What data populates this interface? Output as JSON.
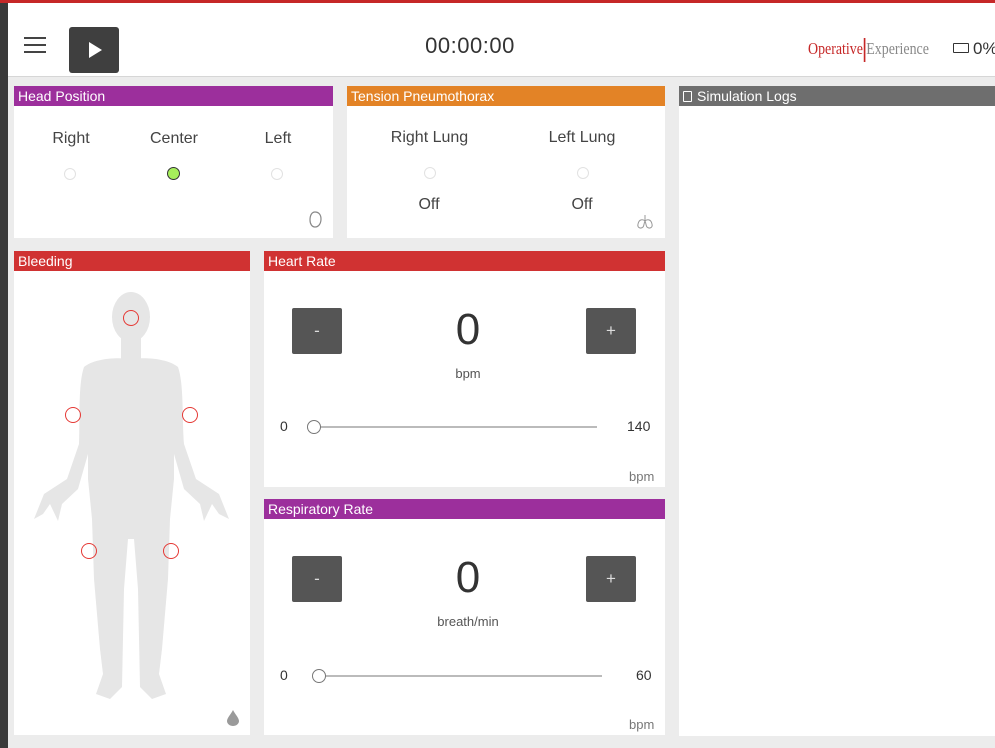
{
  "header": {
    "timer": "00:00:00",
    "brand_primary": "Operative",
    "brand_secondary": "Experience",
    "battery": "0%"
  },
  "colors": {
    "accent_red": "#c62828",
    "panel_purple": "#9c2f9c",
    "panel_orange": "#e38326",
    "panel_red": "#d03232",
    "panel_gray": "#6e6e6e",
    "radio_selected": "#a6ef5b"
  },
  "head_position": {
    "title": "Head Position",
    "options": [
      "Right",
      "Center",
      "Left"
    ],
    "selected": "Center",
    "icon": "head-icon"
  },
  "tension_pneumothorax": {
    "title": "Tension Pneumothorax",
    "right_lung": {
      "label": "Right Lung",
      "status": "Off"
    },
    "left_lung": {
      "label": "Left Lung",
      "status": "Off"
    },
    "icon": "lungs-icon"
  },
  "bleeding": {
    "title": "Bleeding",
    "sites": [
      "head",
      "right-arm",
      "left-arm",
      "right-leg",
      "left-leg"
    ],
    "icon": "blood-drop-icon"
  },
  "heart_rate": {
    "title": "Heart Rate",
    "decrement": "-",
    "increment": "+",
    "value": "0",
    "unit": "bpm",
    "slider_min": "0",
    "slider_max": "140",
    "slider_value": 0,
    "footer_unit": "bpm"
  },
  "respiratory_rate": {
    "title": "Respiratory Rate",
    "decrement": "-",
    "increment": "+",
    "value": "0",
    "unit": "breath/min",
    "slider_min": "0",
    "slider_max": "60",
    "slider_value": 0,
    "footer_unit": "bpm"
  },
  "simulation_logs": {
    "title": "Simulation Logs",
    "icon": "clipboard-icon"
  }
}
